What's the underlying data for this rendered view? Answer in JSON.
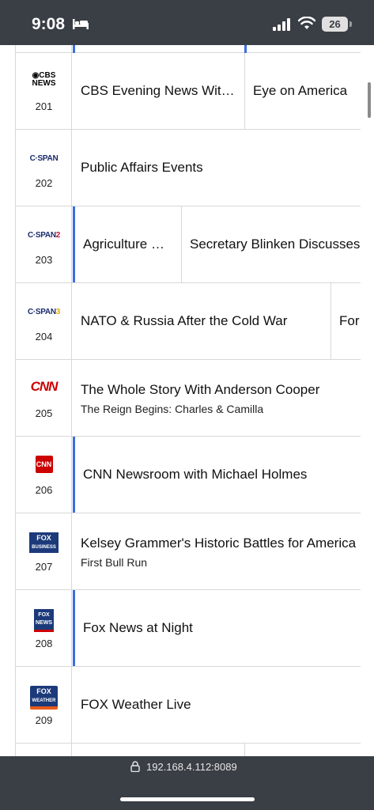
{
  "status_bar": {
    "time": "9:08",
    "battery": "26",
    "icons": [
      "bed-icon",
      "signal-icon",
      "wifi-icon",
      "battery-icon"
    ]
  },
  "guide": {
    "rows": [
      {
        "logo": "CBS NEWS",
        "number": "201",
        "programs": [
          {
            "title": "CBS Evening News Wit…",
            "subtitle": ""
          },
          {
            "title": "Eye on America",
            "subtitle": ""
          }
        ]
      },
      {
        "logo": "C-SPAN",
        "number": "202",
        "programs": [
          {
            "title": "Public Affairs Events",
            "subtitle": ""
          }
        ]
      },
      {
        "logo": "C-SPAN2",
        "number": "203",
        "programs": [
          {
            "title": "Agriculture …",
            "subtitle": ""
          },
          {
            "title": "Secretary Blinken Discusses",
            "subtitle": ""
          }
        ]
      },
      {
        "logo": "C-SPAN3",
        "number": "204",
        "programs": [
          {
            "title": "NATO & Russia After the Cold War",
            "subtitle": ""
          },
          {
            "title": "For",
            "subtitle": ""
          }
        ]
      },
      {
        "logo": "CNN",
        "number": "205",
        "programs": [
          {
            "title": "The Whole Story With Anderson Cooper",
            "subtitle": "The Reign Begins: Charles & Camilla"
          }
        ]
      },
      {
        "logo": "CNN",
        "number": "206",
        "programs": [
          {
            "title": "CNN Newsroom with Michael Holmes",
            "subtitle": ""
          }
        ]
      },
      {
        "logo": "FOX BUSINESS",
        "number": "207",
        "programs": [
          {
            "title": "Kelsey Grammer's Historic Battles for America",
            "subtitle": "First Bull Run"
          }
        ]
      },
      {
        "logo": "FOX NEWS",
        "number": "208",
        "programs": [
          {
            "title": "Fox News at Night",
            "subtitle": ""
          }
        ]
      },
      {
        "logo": "FOX WEATHER",
        "number": "209",
        "programs": [
          {
            "title": "FOX Weather Live",
            "subtitle": ""
          }
        ]
      }
    ]
  },
  "browser": {
    "url": "192.168.4.112:8089"
  },
  "colors": {
    "live_marker": "#3b6fe0",
    "chrome": "#3a3e45",
    "cnn_red": "#cc0000"
  }
}
